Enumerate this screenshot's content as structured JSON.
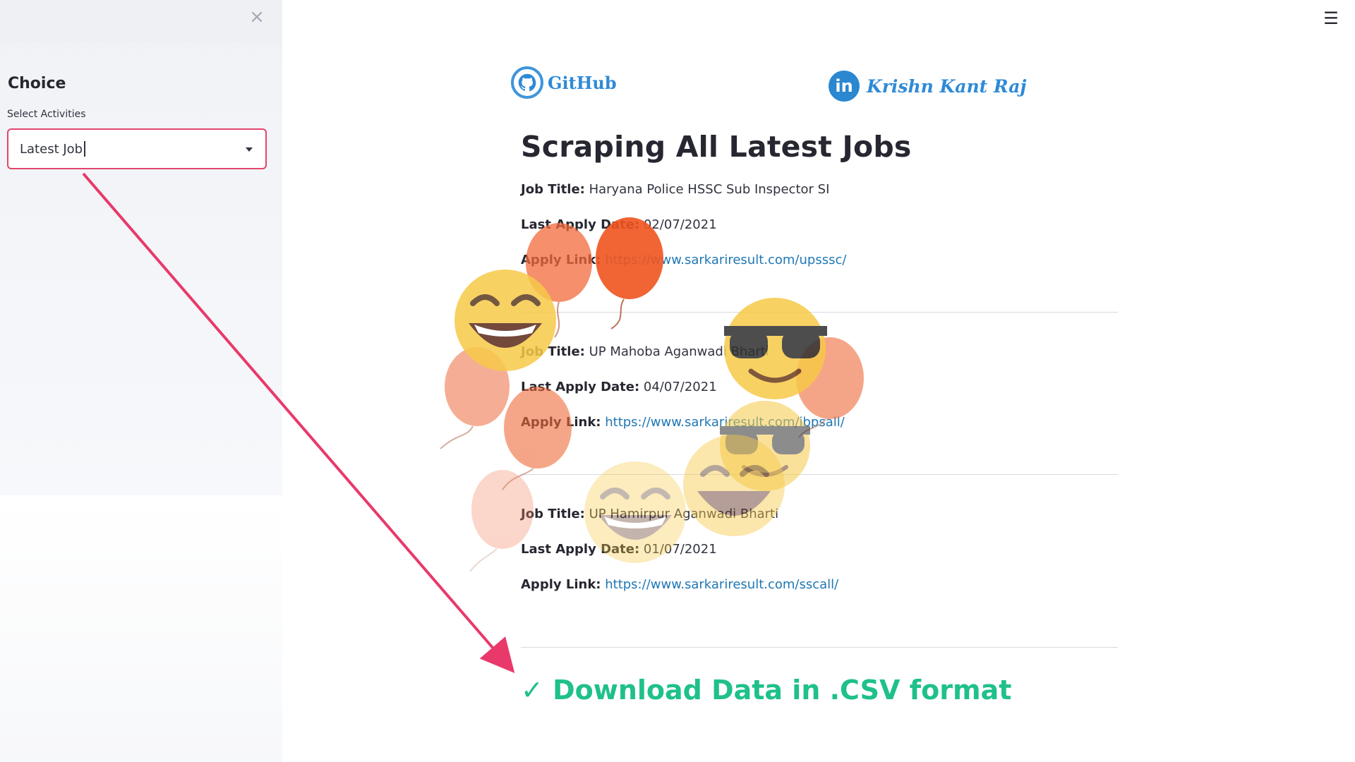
{
  "sidebar": {
    "heading": "Choice",
    "select_label": "Select Activities",
    "select_value": "Latest Job"
  },
  "header": {
    "github_text": "GitHub",
    "linkedin_text": "Krishn Kant Raj"
  },
  "main": {
    "title": "Scraping All Latest Jobs",
    "labels": {
      "job_title": "Job Title:",
      "last_apply": "Last Apply Date:",
      "apply_link": "Apply Link:"
    },
    "jobs": [
      {
        "title": "Haryana Police HSSC Sub Inspector SI",
        "last_apply_date": "02/07/2021",
        "apply_link": "https://www.sarkariresult.com/upsssc/"
      },
      {
        "title": "UP Mahoba Aganwadi Bharti",
        "last_apply_date": "04/07/2021",
        "apply_link": "https://www.sarkariresult.com/ibpsall/"
      },
      {
        "title": "UP Hamirpur Aganwadi Bharti",
        "last_apply_date": "01/07/2021",
        "apply_link": "https://www.sarkariresult.com/sscall/"
      }
    ],
    "download_text": "✓ Download Data in .CSV format"
  },
  "colors": {
    "accent_red": "#e3456d",
    "download_green": "#1fc08b",
    "link_blue": "#1f77b4",
    "brand_blue": "#2f8ad6",
    "arrow_pink": "#e8396a"
  },
  "icons": {
    "close": "close-icon",
    "menu": "hamburger-menu-icon",
    "dropdown": "chevron-down-icon",
    "github": "github-icon",
    "linkedin": "linkedin-icon"
  }
}
